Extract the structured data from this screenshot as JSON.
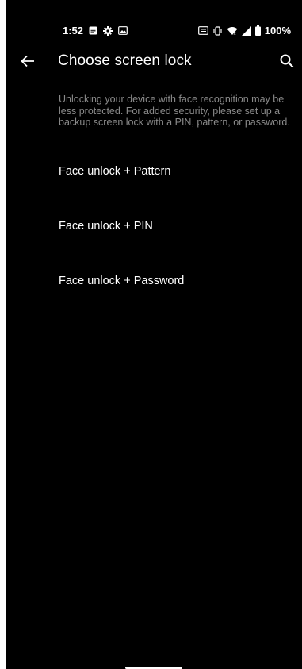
{
  "status_bar": {
    "time": "1:52",
    "battery": "100%",
    "icons_left": [
      "notes-icon",
      "gear-icon",
      "image-icon"
    ],
    "icons_right": [
      "nfc-icon",
      "vibrate-icon",
      "wifi-icon",
      "signal-icon",
      "battery-icon"
    ]
  },
  "app_bar": {
    "title": "Choose screen lock",
    "back_icon": "arrow-left-icon",
    "search_icon": "search-icon"
  },
  "description": "Unlocking your device with face recognition may be less protected. For added security, please set up a backup screen lock with a PIN, pattern, or password.",
  "options": [
    {
      "label": "Face unlock + Pattern"
    },
    {
      "label": "Face unlock + PIN"
    },
    {
      "label": "Face unlock + Password"
    }
  ],
  "colors": {
    "background": "#000000",
    "text_primary": "#ffffff",
    "text_secondary": "#8a8a8a"
  }
}
